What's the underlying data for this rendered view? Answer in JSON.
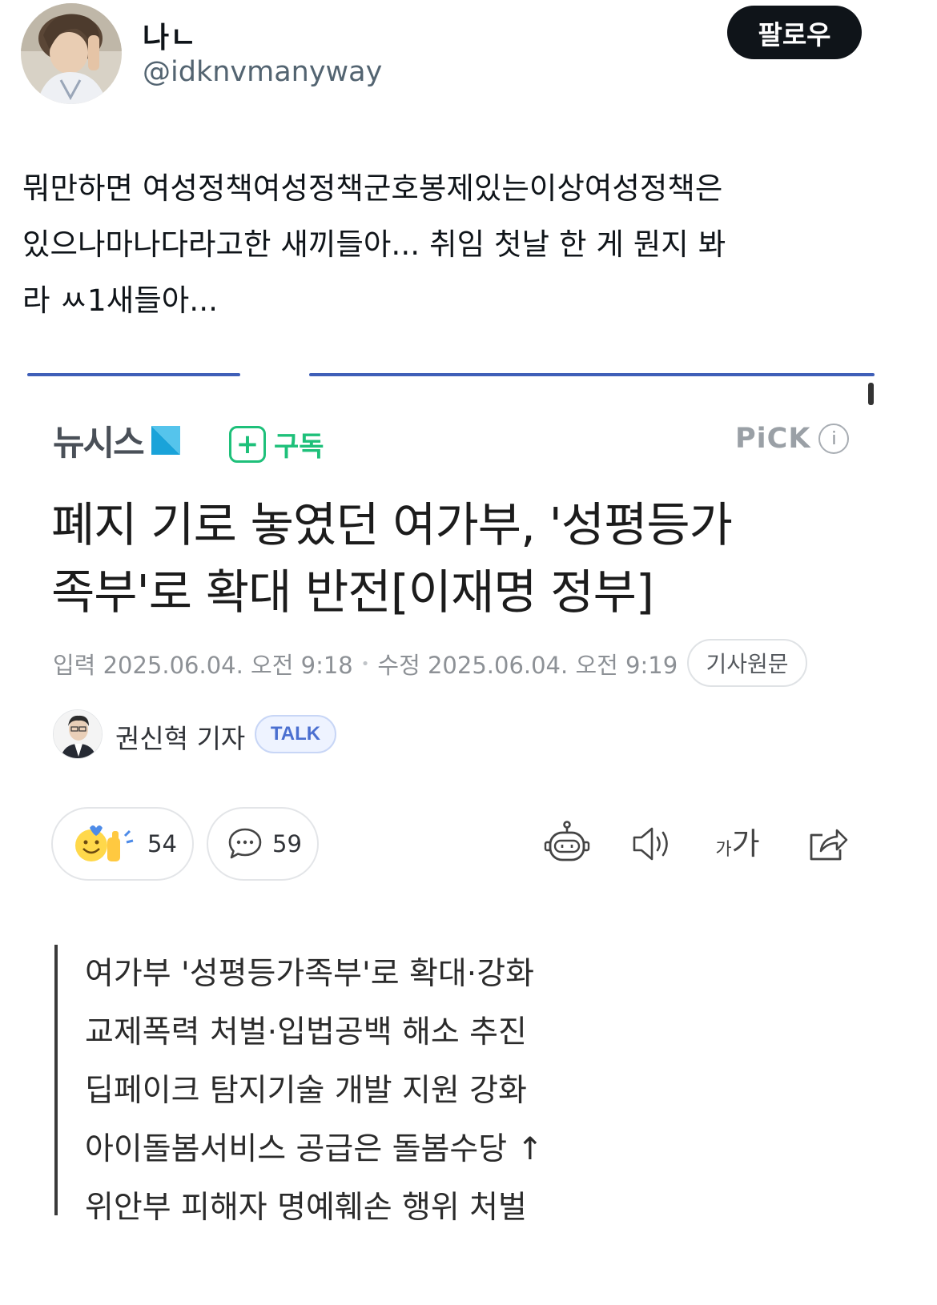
{
  "author": {
    "name": "나ㄴ",
    "handle": "@idknvmanyway"
  },
  "follow_label": "팔로우",
  "tweet_text": "뭐만하면 여성정책여성정책군호봉제있는이상여성정책은\n있으나마나다라고한 새끼들아... 취임 첫날 한 게 뭔지 봐\n라 ㅆ1새들아...",
  "article": {
    "publisher": "뉴시스",
    "subscribe_label": "구독",
    "pick_label": "PiCK",
    "headline": "폐지 기로 놓였던 여가부, '성평등가\n족부'로 확대 반전[이재명 정부]",
    "published": "입력 2025.06.04. 오전 9:18",
    "modified": "수정 2025.06.04. 오전 9:19",
    "original_button": "기사원문",
    "reporter": "권신혁 기자",
    "talk_label": "TALK",
    "reaction_count": "54",
    "comment_count": "59",
    "font_tool_label": "가가",
    "summary": [
      "여가부 '성평등가족부'로 확대·강화",
      "교제폭력 처벌·입법공백 해소 추진",
      "딥페이크 탐지기술 개발 지원 강화",
      "아이돌봄서비스 공급은 돌봄수당 ↑",
      "위안부 피해자 명예훼손 행위 처벌"
    ]
  },
  "colors": {
    "accent_green": "#1ec07a",
    "publisher_blue": "#1aa3d9",
    "talk_blue": "#4a6fd0",
    "follow_bg": "#0f1419"
  },
  "icons": [
    "profile-photo",
    "newsis-logo-mark",
    "plus-icon",
    "info-icon",
    "reporter-photo",
    "emoji-reaction-icon",
    "comment-bubble-icon",
    "ai-bot-icon",
    "speaker-icon",
    "font-size-icon",
    "share-icon"
  ]
}
